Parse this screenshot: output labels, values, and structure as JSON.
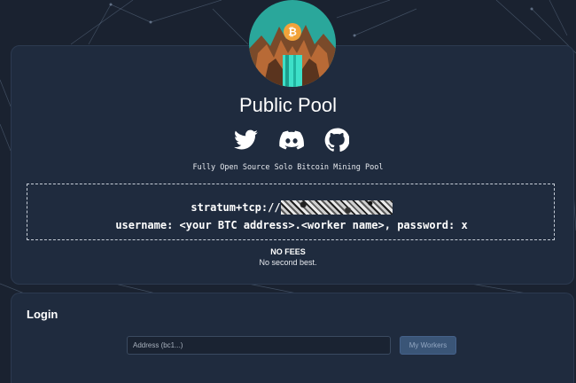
{
  "brand": {
    "title": "Public Pool",
    "tagline": "Fully Open Source Solo Bitcoin Mining Pool"
  },
  "socials": [
    {
      "name": "twitter",
      "icon": "twitter-icon"
    },
    {
      "name": "discord",
      "icon": "discord-icon"
    },
    {
      "name": "github",
      "icon": "github-icon"
    }
  ],
  "connection": {
    "stratum_prefix": "stratum+tcp://",
    "credentials": "username: <your BTC address>.<worker name>, password: x"
  },
  "info": {
    "fees": "NO FEES",
    "note": "No second best."
  },
  "login": {
    "heading": "Login",
    "address_placeholder": "Address (bc1...)",
    "address_value": "",
    "button_label": "My Workers"
  },
  "colors": {
    "background": "#1a2230",
    "card": "#1f2b3e",
    "button": "#3a5577",
    "logo_teal": "#2aa79b",
    "bitcoin_orange": "#f2a33a"
  }
}
